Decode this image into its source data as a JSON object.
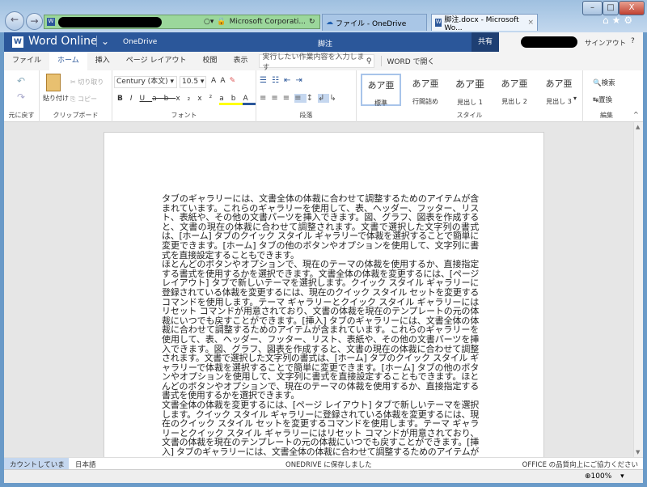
{
  "browser": {
    "address_suffix": "Microsoft Corporati...",
    "tabs": [
      {
        "label": "ファイル - OneDrive"
      },
      {
        "label": "脚注.docx - Microsoft Wo..."
      }
    ],
    "window_buttons": [
      "–",
      "□",
      "X"
    ]
  },
  "header": {
    "app": "Word Online",
    "onedrive": "OneDrive",
    "doc_title": "脚注",
    "share": "共有",
    "signout": "サインアウト",
    "help": "?"
  },
  "tabs": [
    {
      "label": "ファイル"
    },
    {
      "label": "ホーム",
      "selected": true
    },
    {
      "label": "挿入"
    },
    {
      "label": "ページ レイアウト"
    },
    {
      "label": "校閲"
    },
    {
      "label": "表示"
    }
  ],
  "search": {
    "placeholder": "実行したい作業内容を入力します"
  },
  "open_in_word": "WORD で開く",
  "ribbon": {
    "undo_group": "元に戻す",
    "clipboard": {
      "label": "クリップボード",
      "paste": "貼り付け",
      "cut": "切り取り",
      "copy": "コピー"
    },
    "font": {
      "label": "フォント",
      "name": "Century (本文)",
      "size": "10.5"
    },
    "paragraph": {
      "label": "段落"
    },
    "styles": {
      "label": "スタイル",
      "items": [
        {
          "sample": "あア亜",
          "name": "標準"
        },
        {
          "sample": "あア亜",
          "name": "行間詰め"
        },
        {
          "sample": "あア亜",
          "name": "見出し 1"
        },
        {
          "sample": "あア亜",
          "name": "見出し 2"
        },
        {
          "sample": "あア亜",
          "name": "見出し 3"
        }
      ]
    },
    "editing": {
      "label": "編集",
      "find": "検索",
      "replace": "置換"
    }
  },
  "document": {
    "paragraphs": [
      "タブのギャラリーには、文書全体の体裁に合わせて調整するためのアイテムが含まれています。これらのギャラリーを使用して、表、ヘッダー、フッター、リスト、表紙や、その他の文書パーツを挿入できます。図、グラフ、図表を作成すると、文書の現在の体裁に合わせて調整されます。文書で選択した文字列の書式は、[ホーム] タブのクイック スタイル ギャラリーで体裁を選択することで簡単に変更できます。[ホーム] タブの他のボタンやオプションを使用して、文字列に書式を直接設定することもできます。",
      "ほとんどのボタンやオプションで、現在のテーマの体裁を使用するか、直接指定する書式を使用するかを選択できます。文書全体の体裁を変更するには、[ページ レイアウト] タブで新しいテーマを選択します。クイック スタイル ギャラリーに登録されている体裁を変更するには、現在のクイック スタイル セットを変更するコマンドを使用します。テーマ ギャラリーとクイック スタイル ギャラリーにはリセット コマンドが用意されており、文書の体裁を現在のテンプレートの元の体裁にいつでも戻すことができます。[挿入] タブのギャラリーには、文書全体の体裁に合わせて調整するためのアイテムが含まれています。これらのギャラリーを使用して、表、ヘッダー、フッター、リスト、表紙や、その他の文書パーツを挿入できます。図、グラフ、図表を作成すると、文書の現在の体裁に合わせて調整されます。文書で選択した文字列の書式は、[ホーム] タブのクイック スタイル ギャラリーで体裁を選択することで簡単に変更できます。[ホーム] タブの他のボタンやオプションを使用して、文字列に書式を直接設定することもできます。ほとんどのボタンやオプションで、現在のテーマの体裁を使用するか、直接指定する書式を使用するかを選択できます。",
      "文書全体の体裁を変更するには、[ページ レイアウト] タブで新しいテーマを選択します。クイック スタイル ギャラリーに登録されている体裁を変更するには、現在のクイック スタイル セットを変更するコマンドを使用します。テーマ ギャラリーとクイック スタイル ギャラリーにはリセット コマンドが用意されており、文書の体裁を現在のテンプレートの元の体裁にいつでも戻すことができます。[挿入] タブのギャラリーには、文書全体の体裁に合わせて調整するためのアイテムが含まれています。これらのギャラリーを使用して、表、ヘッダー、フッター、リスト、表紙や、その他の文書パーツを挿入できます"
    ]
  },
  "status": {
    "counting": "カウントしています...",
    "language": "日本語",
    "saved": "ONEDRIVE に保存しました",
    "feedback": "OFFICE の品質向上にご協力ください"
  },
  "zoom": "100%",
  "colors": {
    "brand": "#2b579a",
    "share_bg": "#1e3f73"
  }
}
